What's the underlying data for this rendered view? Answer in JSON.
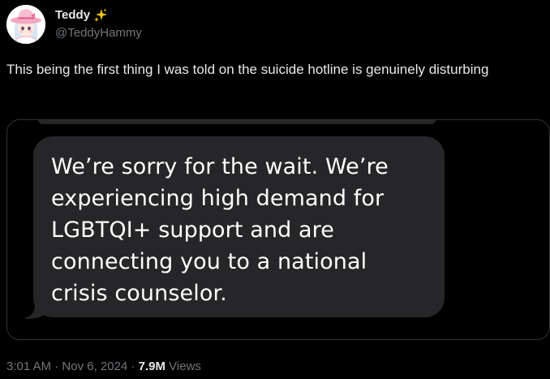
{
  "author": {
    "display_name": "Teddy",
    "handle": "@TeddyHammy",
    "badge_icon": "sparkle-icon",
    "badge_color": "#f5c518"
  },
  "tweet": {
    "text": "This being the first thing I was told on the suicide hotline is genuinely disturbing"
  },
  "media": {
    "message_text": "We’re sorry for the wait. We’re experiencing high demand for LGBTQI+ support and are connecting you to a national crisis counselor.",
    "bubble_color": "#262628"
  },
  "meta": {
    "time": "3:01 AM",
    "separator": "·",
    "date": "Nov 6, 2024",
    "views_count": "7.9M",
    "views_label": "Views"
  },
  "colors": {
    "background": "#000000",
    "primary_text": "#e7e9ea",
    "secondary_text": "#71767b",
    "border": "#2f3336"
  }
}
